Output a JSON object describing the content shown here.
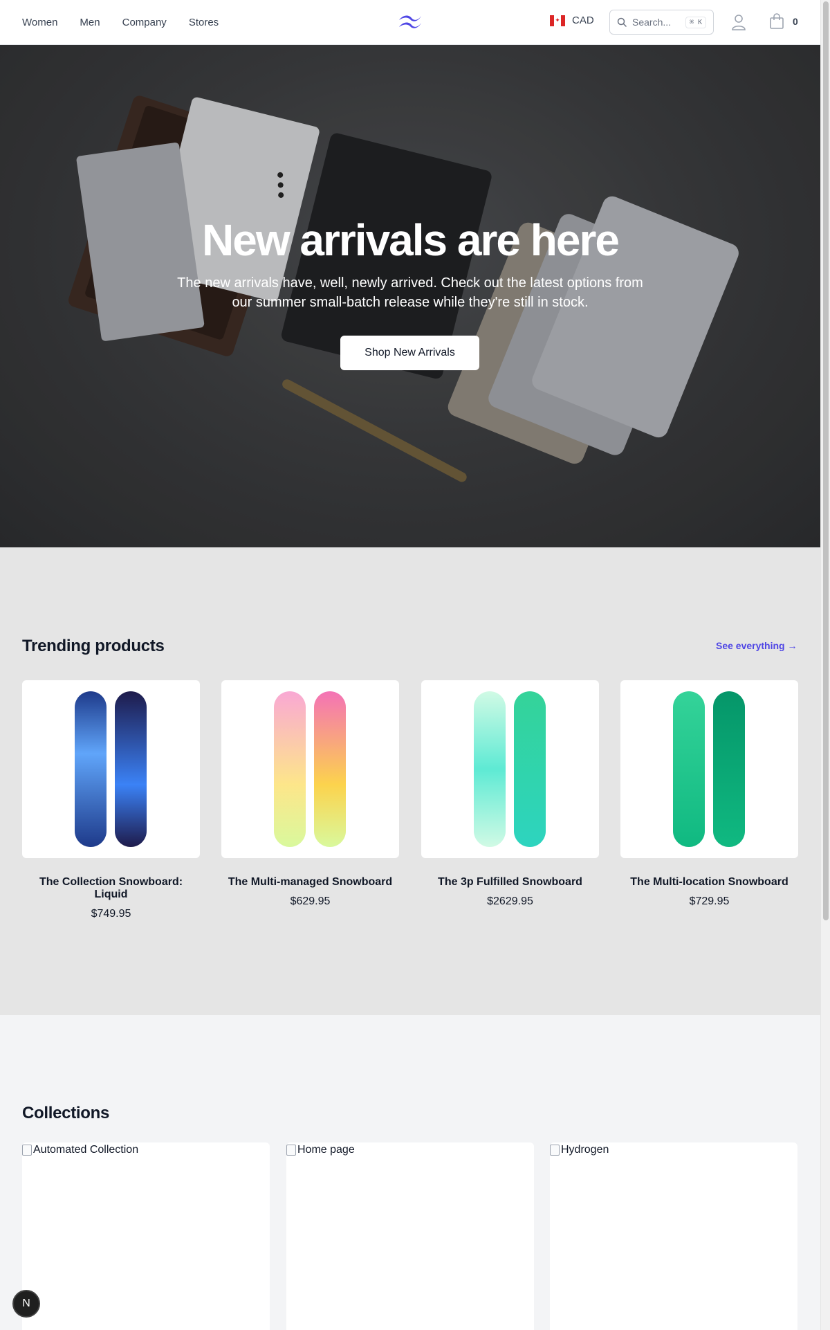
{
  "header": {
    "nav": [
      "Women",
      "Men",
      "Company",
      "Stores"
    ],
    "currency": "CAD",
    "search_placeholder": "Search...",
    "search_shortcut": "⌘ K",
    "cart_count": "0"
  },
  "hero": {
    "title": "New arrivals are here",
    "subtitle": "The new arrivals have, well, newly arrived. Check out the latest options from our summer small-batch release while they're still in stock.",
    "cta": "Shop New Arrivals"
  },
  "trending": {
    "title": "Trending products",
    "see_all": "See everything →",
    "products": [
      {
        "name": "The Collection Snowboard: Liquid",
        "price": "$749.95",
        "colors": [
          "#1e3a8a",
          "#60a5fa"
        ]
      },
      {
        "name": "The Multi-managed Snowboard",
        "price": "$629.95",
        "colors": [
          "#f9a8d4",
          "#d9f99d"
        ]
      },
      {
        "name": "The 3p Fulfilled Snowboard",
        "price": "$2629.95",
        "colors": [
          "#a7f3d0",
          "#2dd4bf"
        ]
      },
      {
        "name": "The Multi-location Snowboard",
        "price": "$729.95",
        "colors": [
          "#34d399",
          "#059669"
        ]
      }
    ]
  },
  "collections": {
    "title": "Collections",
    "items": [
      "Automated Collection",
      "Home page",
      "Hydrogen"
    ]
  },
  "dev_badge": "N"
}
